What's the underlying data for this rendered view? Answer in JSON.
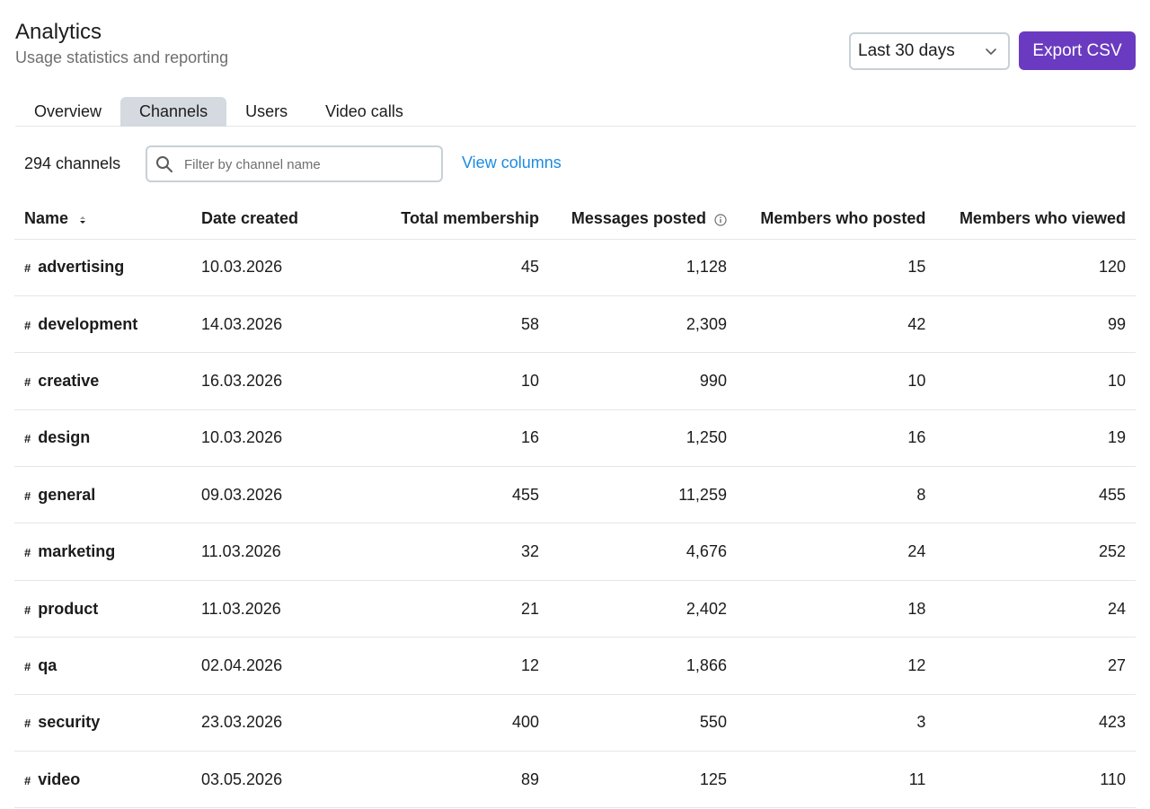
{
  "header": {
    "title": "Analytics",
    "subtitle": "Usage statistics and reporting"
  },
  "range": {
    "selected": "Last 30 days",
    "icon": "chevron-down-icon"
  },
  "export": {
    "label": "Export CSV",
    "color": "#6a3bc0"
  },
  "tabs": [
    {
      "label": "Overview",
      "active": false
    },
    {
      "label": "Channels",
      "active": true
    },
    {
      "label": "Users",
      "active": false
    },
    {
      "label": "Video calls",
      "active": false
    }
  ],
  "toolbar": {
    "count": "294 channels",
    "filter_placeholder": "Filter by channel name",
    "filter_icon": "search-icon",
    "view_columns": "View columns"
  },
  "table": {
    "columns": [
      "Name",
      "Date created",
      "Total membership",
      "Messages posted",
      "Members who posted",
      "Members who viewed"
    ],
    "rows": [
      {
        "name": "advertising",
        "date": "10.03.2026",
        "membership": "45",
        "messages": "1,128",
        "posted": "15",
        "viewed": "120"
      },
      {
        "name": "development",
        "date": "14.03.2026",
        "membership": "58",
        "messages": "2,309",
        "posted": "42",
        "viewed": "99"
      },
      {
        "name": "creative",
        "date": "16.03.2026",
        "membership": "10",
        "messages": "990",
        "posted": "10",
        "viewed": "10"
      },
      {
        "name": "design",
        "date": "10.03.2026",
        "membership": "16",
        "messages": "1,250",
        "posted": "16",
        "viewed": "19"
      },
      {
        "name": "general",
        "date": "09.03.2026",
        "membership": "455",
        "messages": "11,259",
        "posted": "8",
        "viewed": "455"
      },
      {
        "name": "marketing",
        "date": "11.03.2026",
        "membership": "32",
        "messages": "4,676",
        "posted": "24",
        "viewed": "252"
      },
      {
        "name": "product",
        "date": "11.03.2026",
        "membership": "21",
        "messages": "2,402",
        "posted": "18",
        "viewed": "24"
      },
      {
        "name": "qa",
        "date": "02.04.2026",
        "membership": "12",
        "messages": "1,866",
        "posted": "12",
        "viewed": "27"
      },
      {
        "name": "security",
        "date": "23.03.2026",
        "membership": "400",
        "messages": "550",
        "posted": "3",
        "viewed": "423"
      },
      {
        "name": "video",
        "date": "03.05.2026",
        "membership": "89",
        "messages": "125",
        "posted": "11",
        "viewed": "110"
      }
    ]
  }
}
